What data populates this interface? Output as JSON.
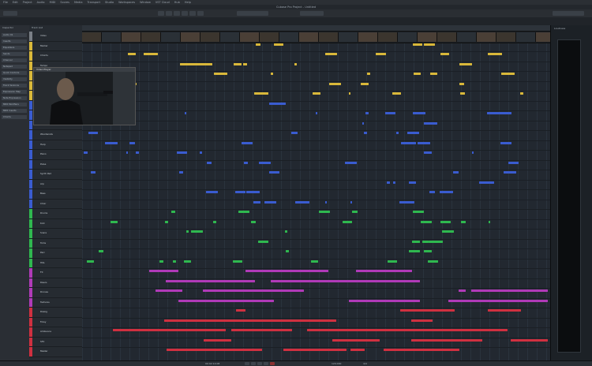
{
  "menu": [
    "File",
    "Edit",
    "Project",
    "Audio",
    "MIDI",
    "Scores",
    "Media",
    "Transport",
    "Studio",
    "Workspaces",
    "Window",
    "VST Cloud",
    "Hub",
    "Help"
  ],
  "window_title": "Cubase Pro Project - Untitled",
  "inspector": {
    "header": "Inspector",
    "rows": [
      "Audio 01",
      "Inserts",
      "Equalizers",
      "Sends",
      "Channel",
      "Notepad",
      "Quick Controls",
      "Visibility",
      "Track Versions",
      "Expression Map",
      "Note Expression",
      "MIDI Modifiers",
      "MIDI Inserts",
      "Chords"
    ]
  },
  "tracklist": {
    "header": "Track List",
    "tracks": [
      {
        "name": "Video",
        "color": "#7a7f86"
      },
      {
        "name": "Marker",
        "color": "#d9b83a"
      },
      {
        "name": "Chords",
        "color": "#d9b83a"
      },
      {
        "name": "Tempo",
        "color": "#d9b83a"
      },
      {
        "name": "Signature",
        "color": "#d9b83a"
      },
      {
        "name": "Audio 01",
        "color": "#d9b83a"
      },
      {
        "name": "Audio 02",
        "color": "#d9b83a"
      },
      {
        "name": "Audio 03",
        "color": "#3a5cd0"
      },
      {
        "name": "Strings",
        "color": "#3a5cd0"
      },
      {
        "name": "Brass",
        "color": "#3a5cd0"
      },
      {
        "name": "Woodwinds",
        "color": "#3a5cd0"
      },
      {
        "name": "Harp",
        "color": "#3a5cd0"
      },
      {
        "name": "Piano",
        "color": "#3a5cd0"
      },
      {
        "name": "Pulse",
        "color": "#3a5cd0"
      },
      {
        "name": "Synth Pad",
        "color": "#3a5cd0"
      },
      {
        "name": "Arp",
        "color": "#3a5cd0"
      },
      {
        "name": "Bass",
        "color": "#3a5cd0"
      },
      {
        "name": "Choir",
        "color": "#3a5cd0"
      },
      {
        "name": "Drums",
        "color": "#2fb84f"
      },
      {
        "name": "Kick",
        "color": "#2fb84f"
      },
      {
        "name": "Snare",
        "color": "#2fb84f"
      },
      {
        "name": "Toms",
        "color": "#2fb84f"
      },
      {
        "name": "Perc",
        "color": "#2fb84f"
      },
      {
        "name": "Hits",
        "color": "#2fb84f"
      },
      {
        "name": "FX",
        "color": "#b03ab8"
      },
      {
        "name": "Risers",
        "color": "#b03ab8"
      },
      {
        "name": "Drones",
        "color": "#b03ab8"
      },
      {
        "name": "Textures",
        "color": "#b03ab8"
      },
      {
        "name": "Dialog",
        "color": "#d03040"
      },
      {
        "name": "Foley",
        "color": "#d03040"
      },
      {
        "name": "Ambience",
        "color": "#d03040"
      },
      {
        "name": "SFX",
        "color": "#d03040"
      },
      {
        "name": "Master",
        "color": "#d03040"
      }
    ]
  },
  "video_window": {
    "title": "Video Player"
  },
  "meter": {
    "header": "Loudness"
  },
  "transport": {
    "position": "00:02:14:08",
    "tempo": "120.000",
    "signature": "4/4"
  },
  "colors": {
    "yellow": "#e0c040",
    "blue": "#4a6ae0",
    "green": "#3cd060",
    "purple": "#b83ac8",
    "red": "#e04050",
    "white": "#c8ccd2"
  }
}
